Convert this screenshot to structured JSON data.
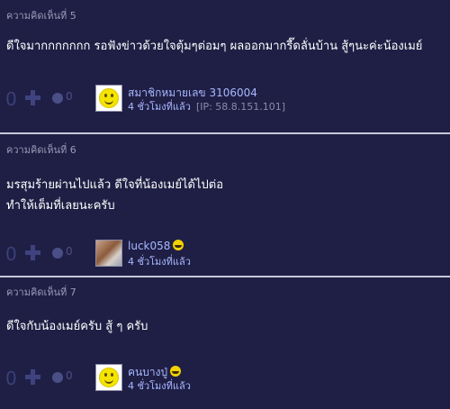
{
  "comments": [
    {
      "title": "ความคิดเห็นที่ 5",
      "lines": [
        "ดีใจมากกกกกกก รอฟังข่าวด้วยใจตุ้มๆต่อมๆ ผลออกมากรี๊ดลั่นบ้าน สู้ๆนะค่ะน้องเมย์"
      ],
      "votes": "0",
      "emotions": "0",
      "author": "สมาชิกหมายเลข 3106004",
      "time": "4 ชั่วโมงที่แล้ว",
      "ip": "[IP: 58.8.151.101]",
      "avatar": "smiley-avatar"
    },
    {
      "title": "ความคิดเห็นที่ 6",
      "lines": [
        "มรสุมร้ายผ่านไปแล้ว ดีใจที่น้องเมย์ได้ไปต่อ",
        "ทำให้เต็มที่เลยนะครับ"
      ],
      "votes": "0",
      "emotions": "0",
      "author": "luck058",
      "time": "4 ชั่วโมงที่แล้ว",
      "avatar": "photo-avatar"
    },
    {
      "title": "ความคิดเห็นที่ 7",
      "lines": [
        "ดีใจกับน้องเมย์ครับ สู้ ๆ ครับ"
      ],
      "votes": "0",
      "emotions": "0",
      "author": "คนบางปู่",
      "time": "4 ชั่วโมงที่แล้ว",
      "avatar": "smiley-avatar"
    }
  ]
}
